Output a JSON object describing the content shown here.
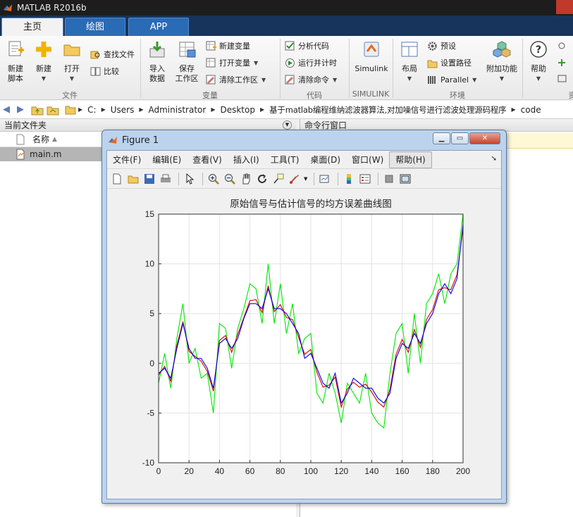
{
  "app": {
    "title": "MATLAB R2016b"
  },
  "tabs": [
    {
      "label": "主页"
    },
    {
      "label": "绘图"
    },
    {
      "label": "APP"
    }
  ],
  "ribbon": {
    "file": {
      "new_script": "新建\n脚本",
      "new": "新建",
      "open": "打开",
      "find_files": "查找文件",
      "compare": "比较",
      "group_label": "文件"
    },
    "variable": {
      "import_data": "导入\n数据",
      "save_workspace": "保存\n工作区",
      "new_variable": "新建变量",
      "open_variable": "打开变量",
      "clear_workspace": "清除工作区",
      "group_label": "变量"
    },
    "code": {
      "analyze_code": "分析代码",
      "run_and_time": "运行并计时",
      "clear_commands": "清除命令",
      "group_label": "代码"
    },
    "simulink": {
      "simulink": "Simulink",
      "group_label": "SIMULINK"
    },
    "environment": {
      "layout": "布局",
      "preferences": "预设",
      "set_path": "设置路径",
      "parallel": "Parallel",
      "addons": "附加功能",
      "group_label": "环境"
    },
    "resources": {
      "help": "帮助",
      "group_label": "资"
    }
  },
  "path": {
    "crumbs": [
      "C:",
      "Users",
      "Administrator",
      "Desktop",
      "基于matlab编程维纳滤波器算法,对加噪信号进行滤波处理源码程序",
      "code"
    ]
  },
  "current_folder": {
    "title": "当前文件夹",
    "column_name": "名称",
    "files": [
      {
        "name": "main.m"
      }
    ]
  },
  "command_window": {
    "title": "命令行窗口"
  },
  "figure": {
    "title": "Figure 1",
    "menus": [
      "文件(F)",
      "编辑(E)",
      "查看(V)",
      "插入(I)",
      "工具(T)",
      "桌面(D)",
      "窗口(W)",
      "帮助(H)"
    ],
    "toolbar_icons": [
      "new-figure-icon",
      "open-file-icon",
      "save-icon",
      "print-icon",
      "pointer-icon",
      "zoom-in-icon",
      "zoom-out-icon",
      "pan-icon",
      "rotate-icon",
      "data-cursor-icon",
      "brush-icon",
      "link-plot-icon",
      "colorbar-icon",
      "legend-icon",
      "hide-plot-tools-icon",
      "show-plot-tools-icon"
    ]
  },
  "chart_data": {
    "type": "line",
    "title": "原始信号与估计信号的均方误差曲线图",
    "xlabel": "",
    "ylabel": "",
    "xlim": [
      0,
      200
    ],
    "ylim": [
      -10,
      15
    ],
    "xticks": [
      0,
      20,
      40,
      60,
      80,
      100,
      120,
      140,
      160,
      180,
      200
    ],
    "yticks": [
      -10,
      -5,
      0,
      5,
      10,
      15
    ],
    "grid": true,
    "colors": {
      "noisy": "#00e600",
      "est_a": "#d40000",
      "est_b": "#0000e6"
    },
    "x": [
      0,
      4,
      8,
      12,
      16,
      20,
      24,
      28,
      32,
      36,
      40,
      44,
      48,
      52,
      56,
      60,
      64,
      68,
      72,
      76,
      80,
      84,
      88,
      92,
      96,
      100,
      104,
      108,
      112,
      116,
      120,
      124,
      128,
      132,
      136,
      140,
      144,
      148,
      152,
      156,
      160,
      164,
      168,
      172,
      176,
      180,
      184,
      188,
      192,
      196,
      200
    ],
    "series": [
      {
        "values": [
          -1,
          -0.5,
          -1.5,
          1.5,
          4,
          1.5,
          0.5,
          0.5,
          -0.5,
          -2.5,
          2,
          2.5,
          1.5,
          2.5,
          4.5,
          6,
          6,
          5.5,
          7.5,
          5.5,
          5.5,
          5,
          4,
          3,
          0.5,
          1,
          -0.5,
          -2,
          -2.5,
          -1,
          -4,
          -3,
          -1.5,
          -2,
          -2.5,
          -2.5,
          -3.5,
          -4,
          -3,
          0.5,
          2,
          1.5,
          3,
          2,
          4,
          5,
          7,
          8,
          7,
          8.5,
          14
        ]
      },
      {
        "values": [
          -1.2,
          -0.3,
          -1.8,
          1.8,
          4.2,
          1.2,
          0.7,
          0.2,
          -0.8,
          -2.8,
          2.3,
          2.8,
          1.1,
          2.9,
          4.6,
          6.3,
          6.4,
          5.1,
          7.8,
          5.2,
          5.9,
          4.6,
          4.4,
          2.6,
          0.9,
          1.4,
          -0.9,
          -2.4,
          -2.2,
          -1.4,
          -4.4,
          -2.6,
          -1.9,
          -2.4,
          -2.1,
          -2.9,
          -3.9,
          -4.4,
          -2.6,
          0.9,
          2.4,
          1.1,
          3.4,
          1.6,
          4.4,
          5.4,
          7.4,
          7.6,
          7.4,
          8.9,
          13.6
        ]
      },
      {
        "values": [
          -2,
          1,
          -2.5,
          2.5,
          6,
          0,
          1.5,
          -1.5,
          -1,
          -5,
          4,
          3.5,
          -0.5,
          3.5,
          5.5,
          8,
          7.5,
          4,
          10,
          4,
          8,
          3,
          6,
          1,
          2.5,
          3,
          -3,
          -4,
          -1,
          -3,
          -6,
          -2,
          -3,
          -4,
          -1,
          -5,
          -6,
          -6.5,
          -1,
          3,
          4,
          -1,
          5,
          0,
          6,
          7,
          9,
          6,
          9,
          10,
          15
        ]
      }
    ]
  }
}
